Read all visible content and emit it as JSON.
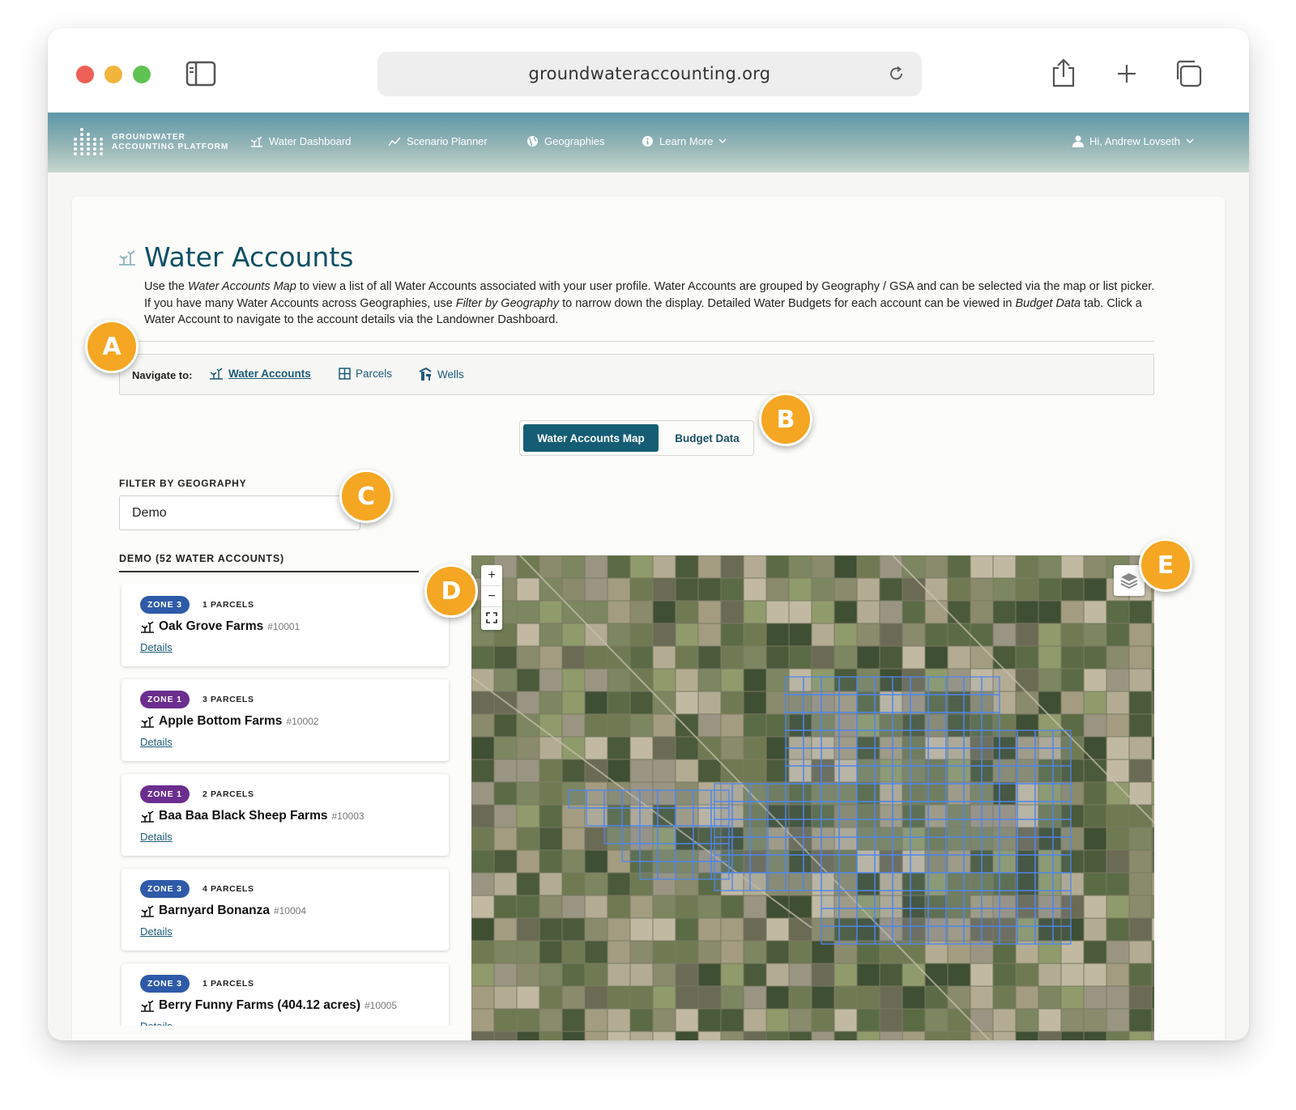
{
  "browser": {
    "url": "groundwateraccounting.org"
  },
  "app": {
    "logo_line1": "GROUNDWATER",
    "logo_line2": "ACCOUNTING PLATFORM",
    "nav": [
      {
        "label": "Water Dashboard",
        "icon": "plant-icon"
      },
      {
        "label": "Scenario Planner",
        "icon": "trend-line-icon"
      },
      {
        "label": "Geographies",
        "icon": "globe-icon"
      },
      {
        "label": "Learn More",
        "icon": "info-icon"
      }
    ],
    "user_greeting": "Hi, Andrew Lovseth"
  },
  "page": {
    "title": "Water Accounts",
    "intro": [
      {
        "t": "Use the ",
        "i": false
      },
      {
        "t": "Water Accounts Map",
        "i": true
      },
      {
        "t": " to view a list of all Water Accounts associated with your user profile. Water Accounts are grouped by Geography / GSA and can be selected via the map or list picker. If you have many Water Accounts across Geographies, use ",
        "i": false
      },
      {
        "t": "Filter by Geography",
        "i": true
      },
      {
        "t": " to narrow down the display. Detailed Water Budgets for each account can be viewed in ",
        "i": false
      },
      {
        "t": "Budget Data",
        "i": true
      },
      {
        "t": " tab. Click a Water Account to navigate to the account details via the Landowner Dashboard.",
        "i": false
      }
    ],
    "navigate_label": "Navigate to:",
    "navigate_links": [
      {
        "label": "Water Accounts",
        "icon": "plant-icon"
      },
      {
        "label": "Parcels",
        "icon": "grid-icon"
      },
      {
        "label": "Wells",
        "icon": "well-icon"
      }
    ],
    "tabs": {
      "active": "Water Accounts Map",
      "inactive": "Budget Data"
    },
    "filter_label": "FILTER BY GEOGRAPHY",
    "filter_value": "Demo",
    "list_header": "DEMO (52 WATER ACCOUNTS)",
    "details_label": "Details",
    "accounts": [
      {
        "zone": "ZONE 3",
        "zone_color": "#2e5aa8",
        "parcels": "1 PARCELS",
        "name": "Oak Grove Farms",
        "number": "#10001"
      },
      {
        "zone": "ZONE 1",
        "zone_color": "#6b2e8e",
        "parcels": "3 PARCELS",
        "name": "Apple Bottom Farms",
        "number": "#10002"
      },
      {
        "zone": "ZONE 1",
        "zone_color": "#6b2e8e",
        "parcels": "2 PARCELS",
        "name": "Baa Baa Black Sheep Farms",
        "number": "#10003"
      },
      {
        "zone": "ZONE 3",
        "zone_color": "#2e5aa8",
        "parcels": "4 PARCELS",
        "name": "Barnyard Bonanza",
        "number": "#10004"
      },
      {
        "zone": "ZONE 3",
        "zone_color": "#2e5aa8",
        "parcels": "1 PARCELS",
        "name": "Berry Funny Farms (404.12 acres)",
        "number": "#10005"
      }
    ],
    "map_controls": {
      "zoom_in": "+",
      "zoom_out": "−"
    }
  },
  "callouts": [
    "A",
    "B",
    "C",
    "D",
    "E"
  ]
}
